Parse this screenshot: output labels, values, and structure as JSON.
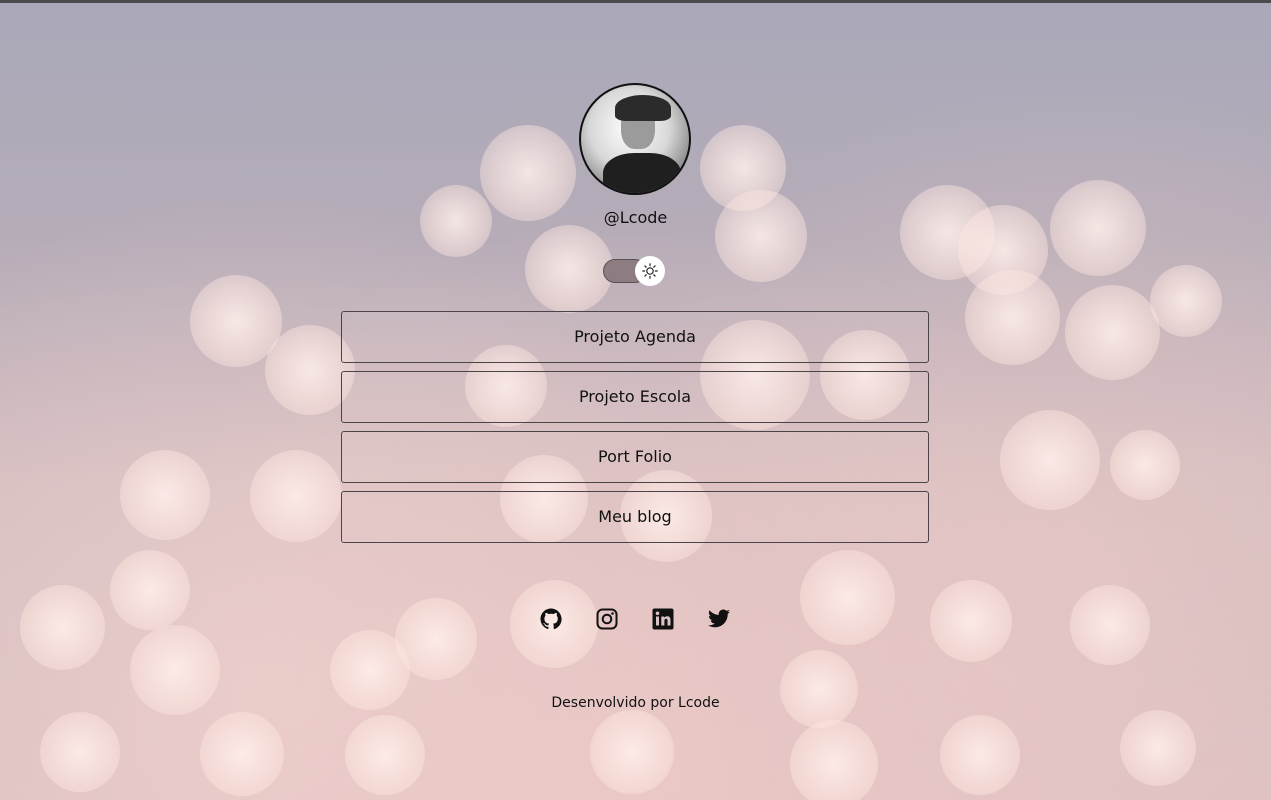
{
  "profile": {
    "username": "@Lcode",
    "avatar_alt": "avatar"
  },
  "theme_toggle": {
    "icon": "sun-icon",
    "state": "light"
  },
  "links": [
    {
      "label": "Projeto Agenda"
    },
    {
      "label": "Projeto Escola"
    },
    {
      "label": "Port Folio"
    },
    {
      "label": "Meu blog"
    }
  ],
  "socials": [
    {
      "icon": "github-icon"
    },
    {
      "icon": "instagram-icon"
    },
    {
      "icon": "linkedin-icon"
    },
    {
      "icon": "twitter-icon"
    }
  ],
  "footer": {
    "text": "Desenvolvido por Lcode"
  },
  "colors": {
    "text": "#111111",
    "border": "#4a4448",
    "toggle_track": "#8d7d82"
  }
}
